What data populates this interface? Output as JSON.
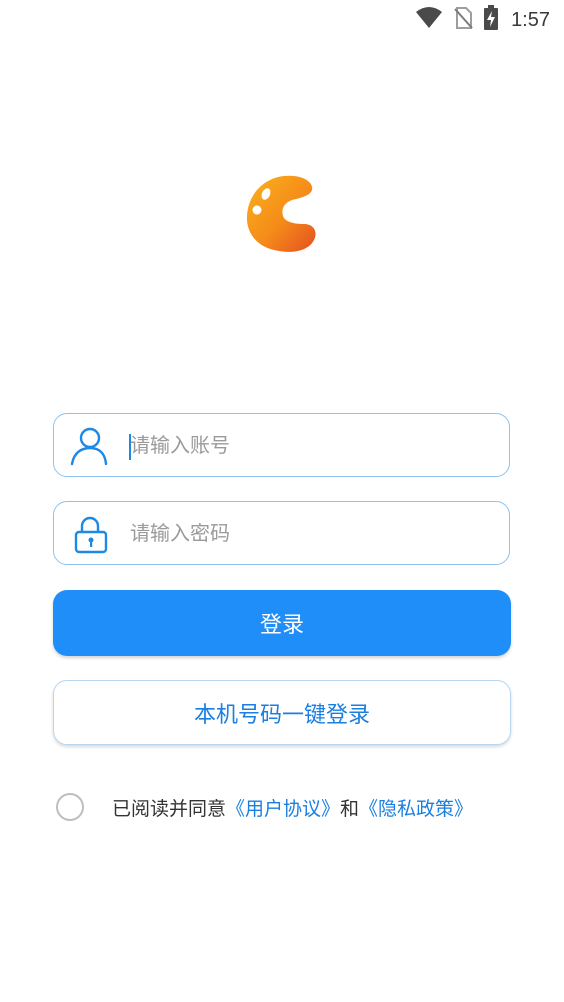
{
  "status_bar": {
    "time": "1:57",
    "icons": [
      "wifi-icon",
      "no-sim-icon",
      "battery-charging-icon"
    ]
  },
  "logo": {
    "icon": "app-logo-c",
    "colors": {
      "top": "#f9a91c",
      "bottom": "#e8541f",
      "accent": "#ffffff"
    }
  },
  "login_form": {
    "account": {
      "placeholder": "请输入账号",
      "value": "",
      "icon": "user-icon"
    },
    "password": {
      "placeholder": "请输入密码",
      "value": "",
      "icon": "lock-icon"
    },
    "login_button": "登录",
    "one_click_login_button": "本机号码一键登录"
  },
  "agreement": {
    "prefix": "已阅读并同意",
    "user_agreement": "《用户协议》",
    "conjunction": "和",
    "privacy_policy": "《隐私政策》",
    "checked": false
  },
  "colors": {
    "primary": "#1f8ef8",
    "link": "#1a7fe0",
    "field_border": "#8ec3ef",
    "icon_stroke": "#1e88e5"
  }
}
